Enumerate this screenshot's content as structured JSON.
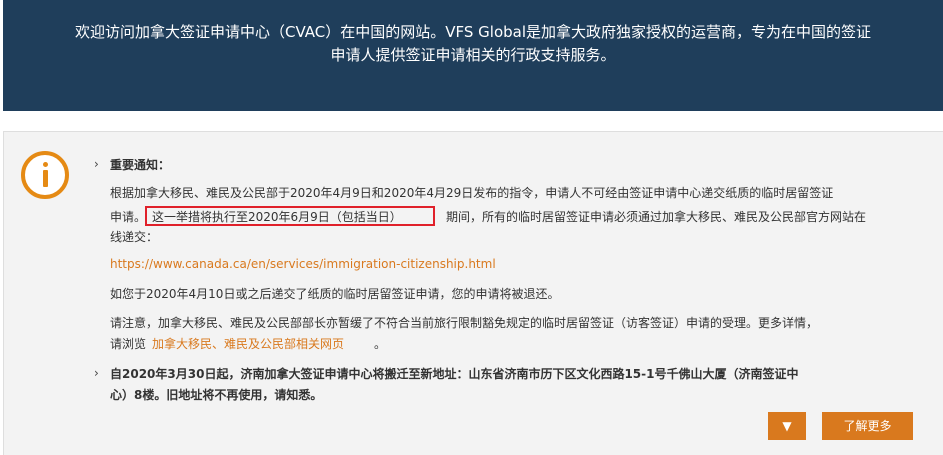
{
  "hero": {
    "line1": "欢迎访问加拿大签证申请中心（CVAC）在中国的网站。VFS Global是加拿大政府独家授权的运营商，专为在中国的签证",
    "line2": "申请人提供签证申请相关的行政支持服务。"
  },
  "notice": {
    "item1_title": "重要通知：",
    "p1_line1": "根据加拿大移民、难民及公民部于2020年4月9日和2020年4月29日发布的指令，申请人不可经由签证申请中心递交纸质的临时居留签证",
    "p1_line2_a": "申请。",
    "p1_line2_highlight": "这一举措将执行至2020年6月9日（包括当日）",
    "p1_line2_b": "期间，所有的临时居留签证申请必须通过加拿大移民、难民及公民部官方网站在",
    "p1_line3": "线递交：",
    "link_url": "https://www.canada.ca/en/services/immigration-citizenship.html",
    "p2": "如您于2020年4月10日或之后递交了纸质的临时居留签证申请，您的申请将被退还。",
    "p3_line1": "请注意，加拿大移民、难民及公民部部长亦暂缓了不符合当前旅行限制豁免规定的临时居留签证（访客签证）申请的受理。更多详情，",
    "p3_line2_a": "请浏览",
    "p3_line2_link": "加拿大移民、难民及公民部相关网页",
    "p3_line2_b": "。",
    "item2_line1": "自2020年3月30日起，济南加拿大签证申请中心将搬迁至新地址：山东省济南市历下区文化西路15-1号千佛山大厦（济南签证中",
    "item2_line2": "心）8楼。旧地址将不再使用，请知悉。",
    "toggle_label": "▼",
    "more_label": "了解更多"
  },
  "icons": {
    "info": "info-icon",
    "chevron": "chevron-right-icon",
    "toggle": "triangle-down-icon"
  },
  "colors": {
    "hero_bg": "#1f3e5b",
    "accent": "#d9791e",
    "highlight_border": "#e0202a",
    "panel_bg": "#f3f3f3"
  }
}
